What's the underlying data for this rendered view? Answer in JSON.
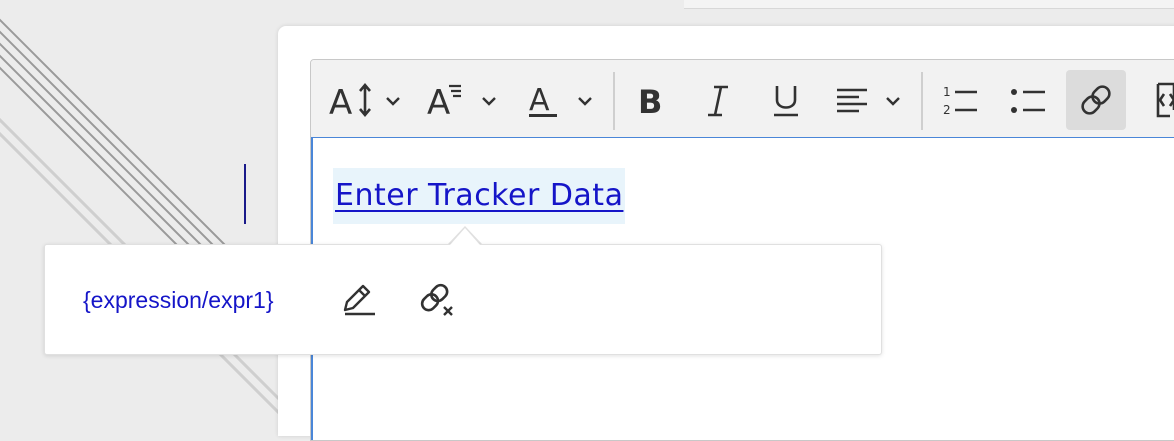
{
  "toolbar": {
    "buttons": [
      {
        "icon": "font-size-icon",
        "dropdown": true
      },
      {
        "icon": "line-height-icon",
        "dropdown": true
      },
      {
        "icon": "font-color-icon",
        "dropdown": true
      },
      {
        "icon": "bold-icon"
      },
      {
        "icon": "italic-icon"
      },
      {
        "icon": "underline-icon"
      },
      {
        "icon": "align-icon",
        "dropdown": true
      },
      {
        "icon": "numbered-list-icon"
      },
      {
        "icon": "bullet-list-icon"
      },
      {
        "icon": "link-icon",
        "active": true
      },
      {
        "icon": "source-code-icon"
      }
    ],
    "active_color": "#dcdcdc"
  },
  "editor": {
    "link_text": "Enter Tracker Data",
    "link_color": "#1515c8",
    "focus_border_color": "#4a86d8"
  },
  "link_popover": {
    "url": "{expression/expr1}",
    "edit_icon": "pencil-icon",
    "unlink_icon": "unlink-icon"
  }
}
